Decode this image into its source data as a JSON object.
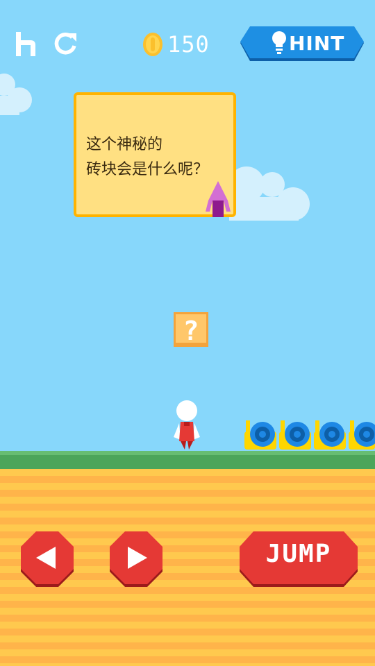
{
  "hud": {
    "home_icon": "home-icon",
    "restart_icon": "restart-icon",
    "coin_icon": "coin-icon",
    "coins": "150",
    "hint_label": "HINT",
    "hint_icon": "lightbulb-icon"
  },
  "dialog": {
    "text": "这个神秘的\n砖块会是什么呢？"
  },
  "block": {
    "symbol": "?"
  },
  "controls": {
    "left_icon": "left-arrow-icon",
    "right_icon": "right-arrow-icon",
    "jump_label": "JUMP"
  },
  "colors": {
    "sky": "#87d7fb",
    "hint_button": "#1e8fe3",
    "control_button": "#e53935",
    "grass": "#4ca55a",
    "dirt_stripe_a": "#ffc94e",
    "dirt_stripe_b": "#ffb44a",
    "dialog_bg": "#ffe082",
    "dialog_border": "#ffb300"
  }
}
